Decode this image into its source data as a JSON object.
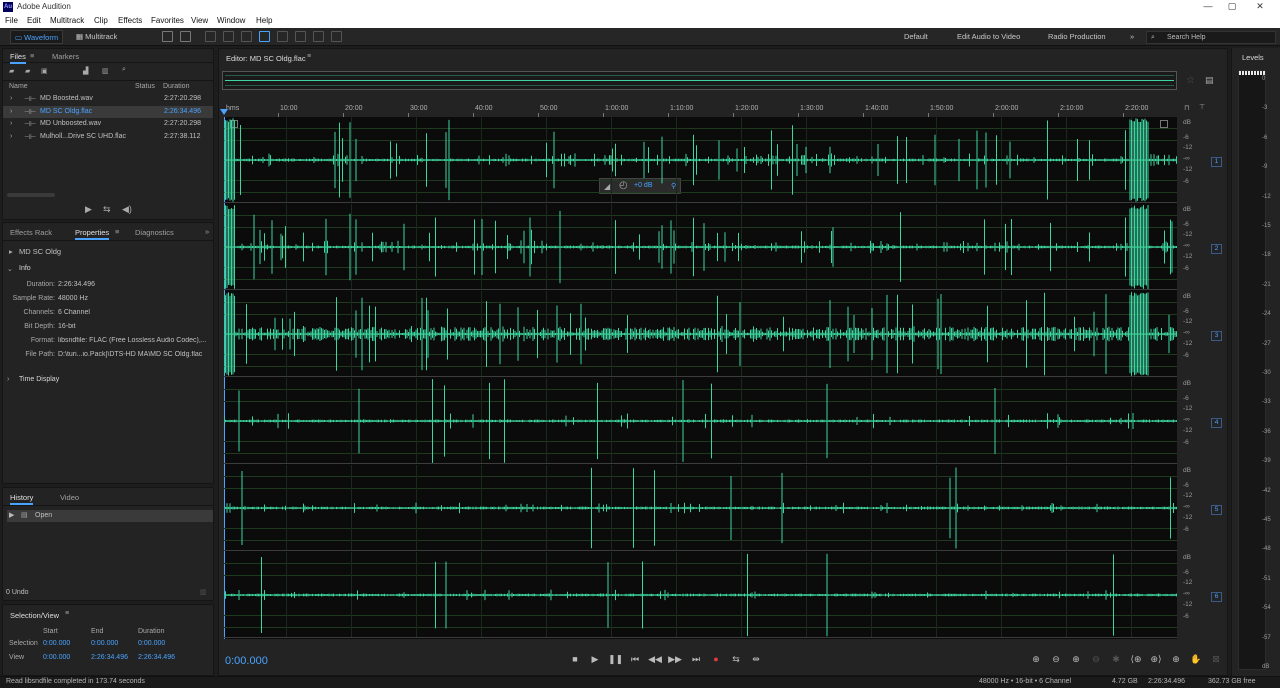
{
  "window": {
    "title": "Adobe Audition",
    "app_icon": "Au"
  },
  "menu": [
    "File",
    "Edit",
    "Multitrack",
    "Clip",
    "Effects",
    "Favorites",
    "View",
    "Window",
    "Help"
  ],
  "toolbar": {
    "waveform_label": "Waveform",
    "multitrack_label": "Multitrack",
    "workspaces": [
      "Default",
      "Edit Audio to Video",
      "Radio Production"
    ],
    "more": "»",
    "search_placeholder": "Search Help"
  },
  "files_panel": {
    "tabs": [
      "Files",
      "Markers"
    ],
    "columns": {
      "name": "Name",
      "status": "Status",
      "duration": "Duration"
    },
    "rows": [
      {
        "name": "MD Boosted.wav",
        "duration": "2:27:20.298",
        "selected": false
      },
      {
        "name": "MD SC Oldg.flac",
        "duration": "2:26:34.496",
        "selected": true
      },
      {
        "name": "MD Unboosted.wav",
        "duration": "2:27:20.298",
        "selected": false
      },
      {
        "name": "Mulholl...Drive SC UHD.flac",
        "duration": "2:27:38.112",
        "selected": false
      }
    ]
  },
  "properties_panel": {
    "tabs": [
      "Effects Rack",
      "Properties",
      "Diagnostics"
    ],
    "file_name": "MD SC Oldg",
    "info_header": "Info",
    "info": [
      {
        "label": "Duration:",
        "value": "2:26:34.496"
      },
      {
        "label": "Sample Rate:",
        "value": "48000 Hz"
      },
      {
        "label": "Channels:",
        "value": "6 Channel"
      },
      {
        "label": "Bit Depth:",
        "value": "16-bit"
      },
      {
        "label": "Format:",
        "value": "libsndfile: FLAC (Free Lossless Audio Codec),..."
      },
      {
        "label": "File Path:",
        "value": "D:\\turi...io.Pack]\\DTS-HD MA\\MD SC Oldg.flac"
      }
    ],
    "time_display": "Time Display"
  },
  "history_panel": {
    "tabs": [
      "History",
      "Video"
    ],
    "items": [
      "Open"
    ],
    "undo": "0 Undo"
  },
  "selection_panel": {
    "title": "Selection/View",
    "columns": [
      "Start",
      "End",
      "Duration"
    ],
    "rows": [
      {
        "label": "Selection",
        "start": "0:00.000",
        "end": "0:00.000",
        "duration": "0:00.000"
      },
      {
        "label": "View",
        "start": "0:00.000",
        "end": "2:26:34.496",
        "duration": "2:26:34.496"
      }
    ]
  },
  "editor": {
    "title": "Editor: MD SC Oldg.flac",
    "ruler_unit": "hms",
    "ruler_labels": [
      "10:00",
      "20:00",
      "30:00",
      "40:00",
      "50:00",
      "1:00:00",
      "1:10:00",
      "1:20:00",
      "1:30:00",
      "1:40:00",
      "1:50:00",
      "2:00:00",
      "2:10:00",
      "2:20:00"
    ],
    "hud_gain": "+0 dB",
    "db_scale": [
      "dB",
      "-6",
      "-12",
      "-∞",
      "-12",
      "-6"
    ],
    "channels": [
      "1",
      "2",
      "3",
      "4",
      "5",
      "6"
    ],
    "waveform_color": "#3ed6a0"
  },
  "transport": {
    "time": "0:00.000"
  },
  "levels": {
    "title": "Levels",
    "ticks": [
      "0",
      "-3",
      "-6",
      "-9",
      "-12",
      "-15",
      "-18",
      "-21",
      "-24",
      "-27",
      "-30",
      "-33",
      "-36",
      "-39",
      "-42",
      "-45",
      "-48",
      "-51",
      "-54",
      "-57",
      "dB"
    ]
  },
  "status": {
    "message": "Read libsndfile completed in 173.74 seconds",
    "format": "48000 Hz • 16-bit • 6 Channel",
    "size": "4.72 GB",
    "duration": "2:26:34.496",
    "free": "362.73 GB free"
  }
}
